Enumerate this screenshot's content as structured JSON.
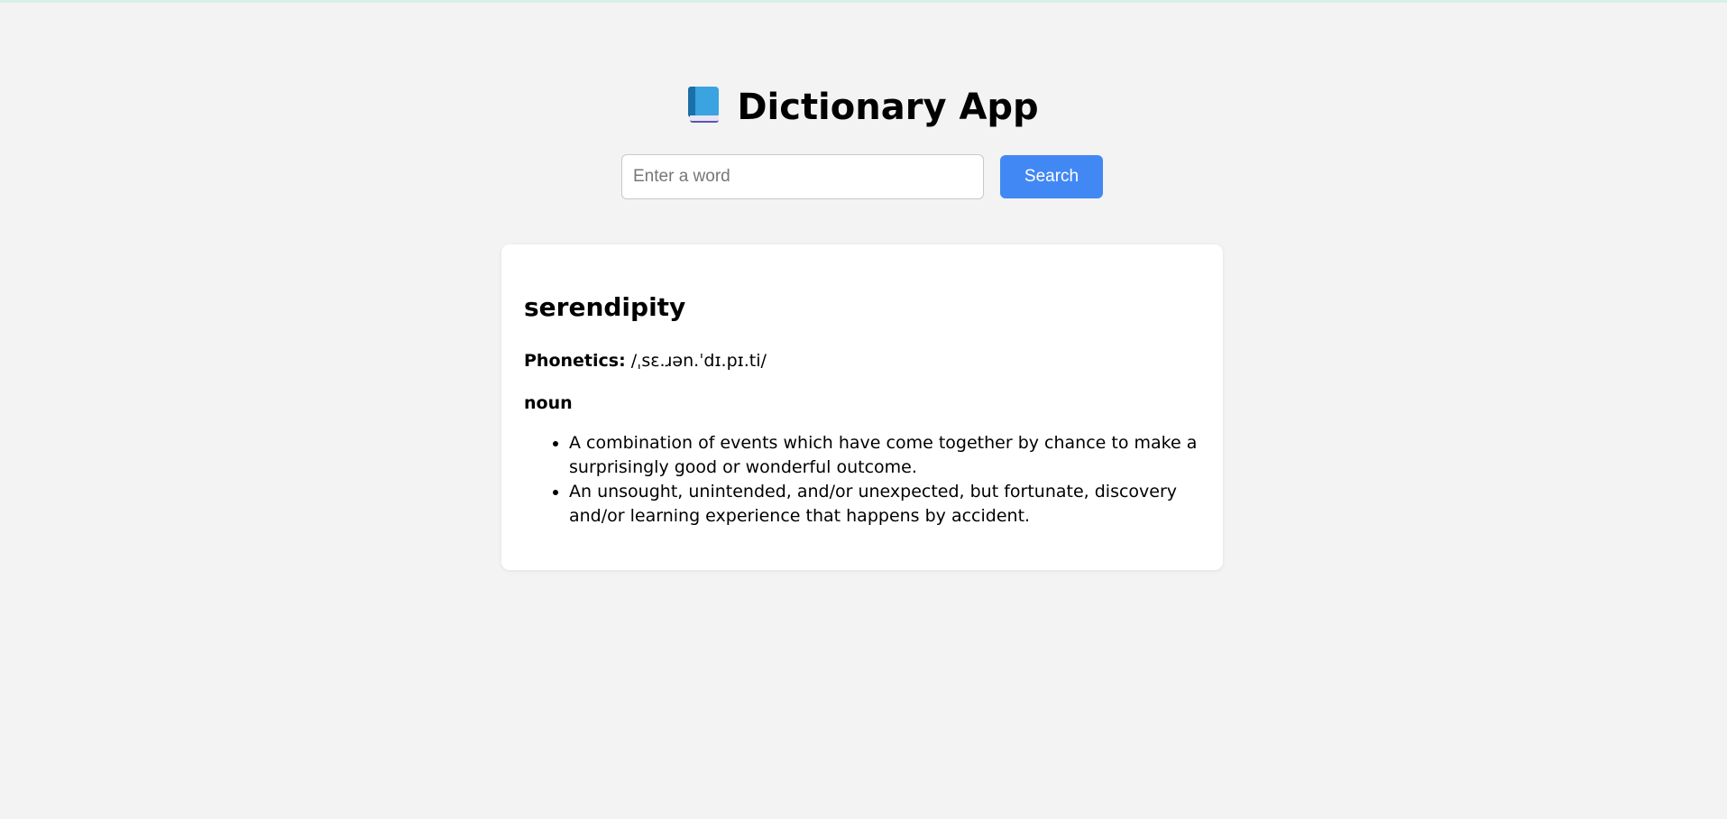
{
  "app": {
    "title": "Dictionary App",
    "title_icon": "book-icon"
  },
  "search": {
    "placeholder": "Enter a word",
    "value": "",
    "button_label": "Search"
  },
  "result": {
    "word": "serendipity",
    "phonetics_label": "Phonetics:",
    "phonetics": "/ˌsɛ.ɹən.ˈdɪ.pɪ.ti/",
    "part_of_speech": "noun",
    "definitions": [
      "A combination of events which have come together by chance to make a surprisingly good or wonderful outcome.",
      "An unsought, unintended, and/or unexpected, but fortunate, discovery and/or learning experience that happens by accident."
    ]
  },
  "colors": {
    "background": "#f3f3f3",
    "accent": "#4288f4",
    "card": "#ffffff"
  }
}
